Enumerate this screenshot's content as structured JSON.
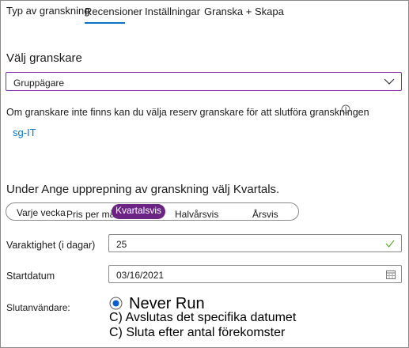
{
  "tabs": [
    {
      "label": "Typ av granskning",
      "active": false
    },
    {
      "label": "Recensioner",
      "active": true
    },
    {
      "label": "Inställningar",
      "active": false
    },
    {
      "label": "Granska +  Skapa",
      "active": false
    }
  ],
  "reviewers": {
    "heading": "Välj granskare",
    "dropdown_value": "Gruppägare",
    "fallback_text": "Om granskare inte finns kan du välja reserv granskare för att slutföra granskningen",
    "fallback_link": "sg-IT"
  },
  "recurrence": {
    "heading": "Under Ange upprepning av granskning välj Kvartals.",
    "options": [
      "Varje vecka",
      "Pris per må",
      "Kvartalsvis",
      "Halvårsvis",
      "Årsvis"
    ],
    "selected": "Kvartalsvis"
  },
  "duration": {
    "label": "Varaktighet (i dagar)",
    "value": "25"
  },
  "start_date": {
    "label": "Startdatum",
    "value": "03/16/2021"
  },
  "end": {
    "label": "Slutanvändare:",
    "options": [
      "Never Run",
      "C) Avslutas det specifika datumet",
      "C) Sluta efter antal förekomster"
    ]
  },
  "colors": {
    "accent": "#0a72c9",
    "purple": "#6b2484",
    "border_focus": "#8a2da5",
    "check": "#5fa82a"
  }
}
